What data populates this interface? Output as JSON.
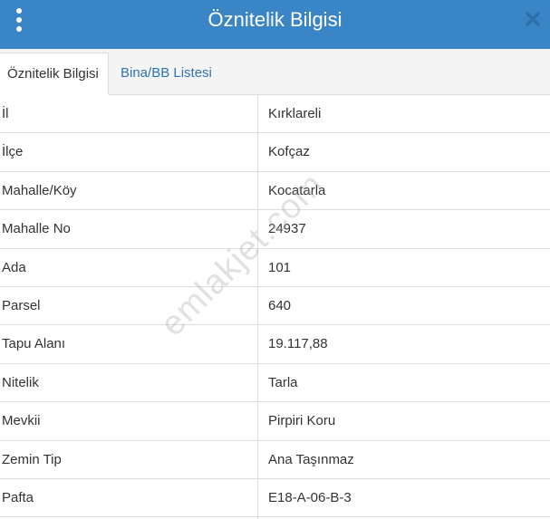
{
  "header": {
    "title": "Öznitelik Bilgisi"
  },
  "tabs": [
    {
      "label": "Öznitelik Bilgisi",
      "active": true
    },
    {
      "label": "Bina/BB Listesi",
      "active": false
    }
  ],
  "attributes": [
    {
      "key": "İl",
      "value": "Kırklareli"
    },
    {
      "key": "İlçe",
      "value": "Kofçaz"
    },
    {
      "key": "Mahalle/Köy",
      "value": "Kocatarla"
    },
    {
      "key": "Mahalle No",
      "value": "24937"
    },
    {
      "key": "Ada",
      "value": "101"
    },
    {
      "key": "Parsel",
      "value": "640"
    },
    {
      "key": "Tapu Alanı",
      "value": "19.117,88"
    },
    {
      "key": "Nitelik",
      "value": "Tarla"
    },
    {
      "key": "Mevkii",
      "value": "Pirpiri Koru"
    },
    {
      "key": "Zemin Tip",
      "value": "Ana Taşınmaz"
    },
    {
      "key": "Pafta",
      "value": "E18-A-06-B-3"
    }
  ],
  "watermark": "emlakjet.com",
  "colors": {
    "header": "#3a85c5",
    "tab_link": "#2f73b3"
  },
  "icons": {
    "menu": "vertical-dots-icon",
    "close": "close-icon"
  }
}
